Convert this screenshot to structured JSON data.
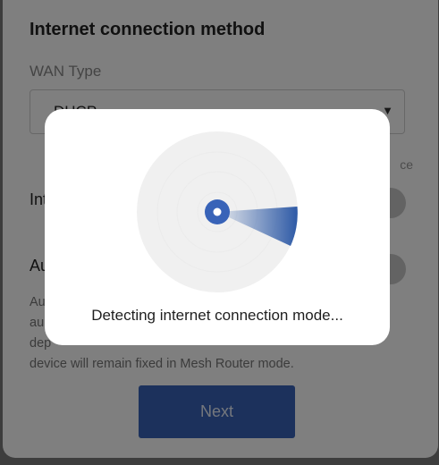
{
  "page": {
    "section_title": "Internet connection method",
    "wan_type_label": "WAN Type",
    "wan_type_value": "DHCP",
    "hint_right": "ce",
    "row1_label": "Int",
    "row2_label": "Au",
    "description_lines": [
      "Au",
      "au",
      "dep",
      "device will remain fixed in Mesh Router mode."
    ],
    "next_button": "Next"
  },
  "modal": {
    "message": "Detecting internet connection mode..."
  },
  "icons": {
    "select_caret": "▼"
  },
  "colors": {
    "accent": "#3863b8",
    "radar_sweep": "#2e5aa6",
    "radar_bg": "#f0f0f0"
  }
}
